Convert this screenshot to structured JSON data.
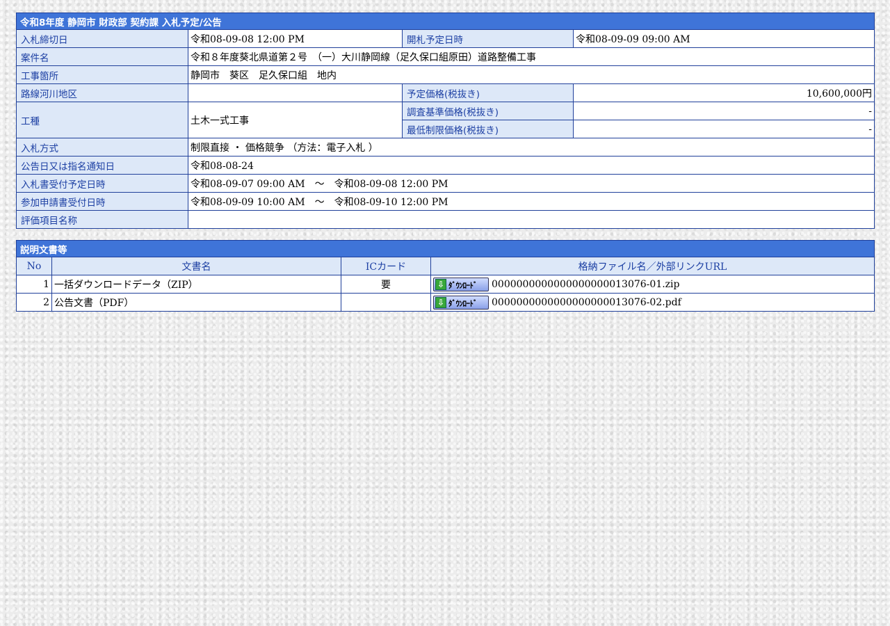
{
  "info": {
    "title": "令和8年度 静岡市 財政部 契約課 入札予定/公告",
    "deadline_label": "入札締切日",
    "deadline_value": "令和08-09-08 12:00 PM",
    "opening_label": "開札予定日時",
    "opening_value": "令和08-09-09 09:00 AM",
    "project_label": "案件名",
    "project_value": "令和８年度葵北県道第２号　（一）大川静岡線（足久保口組原田）道路整備工事",
    "location_label": "工事箇所",
    "location_value": "静岡市　葵区　足久保口組　地内",
    "route_label": "路線河川地区",
    "route_value": "",
    "planned_price_label": "予定価格(税抜き)",
    "planned_price_value": "10,600,000円",
    "work_type_label": "工種",
    "work_type_value": "土木一式工事",
    "survey_price_label": "調査基準価格(税抜き)",
    "survey_price_value": "-",
    "min_price_label": "最低制限価格(税抜き)",
    "min_price_value": "-",
    "bid_method_label": "入札方式",
    "bid_method_value": "制限直接 ・ 価格競争 （方法：電子入札 ）",
    "notice_date_label": "公告日又は指名通知日",
    "notice_date_value": "令和08-08-24",
    "bid_receipt_label": "入札書受付予定日時",
    "bid_receipt_value": "令和08-09-07 09:00 AM　～　令和08-09-08 12:00 PM",
    "application_label": "参加申請書受付日時",
    "application_value": "令和08-09-09 10:00 AM　～　令和08-09-10 12:00 PM",
    "evaluation_label": "評価項目名称",
    "evaluation_value": ""
  },
  "docs": {
    "title": "説明文書等",
    "headers": {
      "no": "No",
      "name": "文書名",
      "iccard": "ICカード",
      "file": "格納ファイル名／外部リンクURL"
    },
    "download_label": "ﾀﾞｳﾝﾛｰﾄﾞ",
    "rows": [
      {
        "no": "1",
        "name": "一括ダウンロードデータ（ZIP）",
        "iccard": "要",
        "file": "0000000000000000000013076-01.zip"
      },
      {
        "no": "2",
        "name": "公告文書（PDF）",
        "iccard": "",
        "file": "0000000000000000000013076-02.pdf"
      }
    ]
  }
}
